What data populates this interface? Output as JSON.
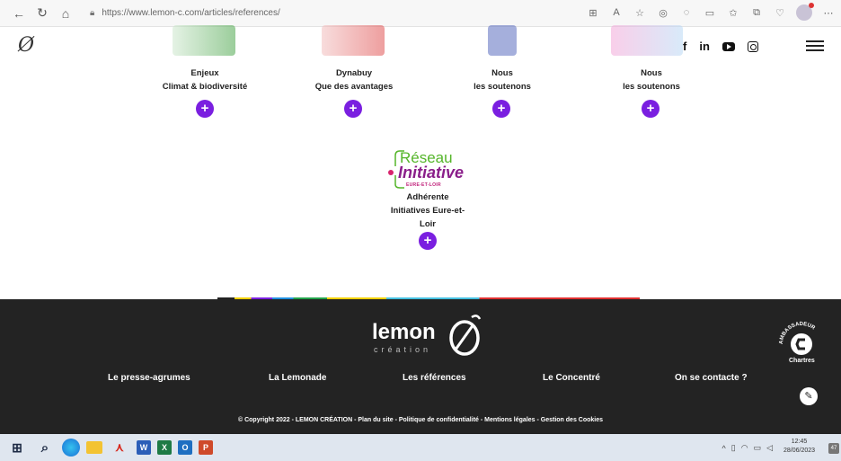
{
  "browser": {
    "url": "https://www.lemon-c.com/articles/references/",
    "back_icon": "←",
    "reload_icon": "↻",
    "home_icon": "⌂"
  },
  "header": {
    "socials": [
      "f",
      "in"
    ]
  },
  "cards": [
    {
      "line1": "Enjeux",
      "line2": "Climat & biodiversité",
      "plus": "+"
    },
    {
      "line1": "Dynabuy",
      "line2": "Que des avantages",
      "plus": "+"
    },
    {
      "line1": "Nous",
      "line2": "les soutenons",
      "plus": "+"
    },
    {
      "line1": "Nous",
      "line2": "les soutenons",
      "plus": "+"
    }
  ],
  "reseau": {
    "logo_line1": "Réseau",
    "logo_line2": "Initiative",
    "logo_line3": "EURE-ET-LOIR",
    "label_line1": "Adhérente",
    "label_line2": "Initiatives Eure-et-",
    "label_line3": "Loir",
    "plus": "+"
  },
  "footer": {
    "brand": "lemon",
    "brand_sub": "création",
    "nav": [
      "Le presse-agrumes",
      "La Lemonade",
      "Les références",
      "Le Concentré",
      "On se contacte ?"
    ],
    "copyright": "© Copyright 2022 - LEMON CRÉATION - Plan du site - Politique de confidentialité - Mentions légales - Gestion des Cookies",
    "badge_label": "Chartres",
    "badge_arc": "AMBASSADEUR",
    "accent": "#7a1fe0"
  },
  "taskbar": {
    "time": "12:45",
    "date": "28/06/2023",
    "notification_count": "47"
  }
}
